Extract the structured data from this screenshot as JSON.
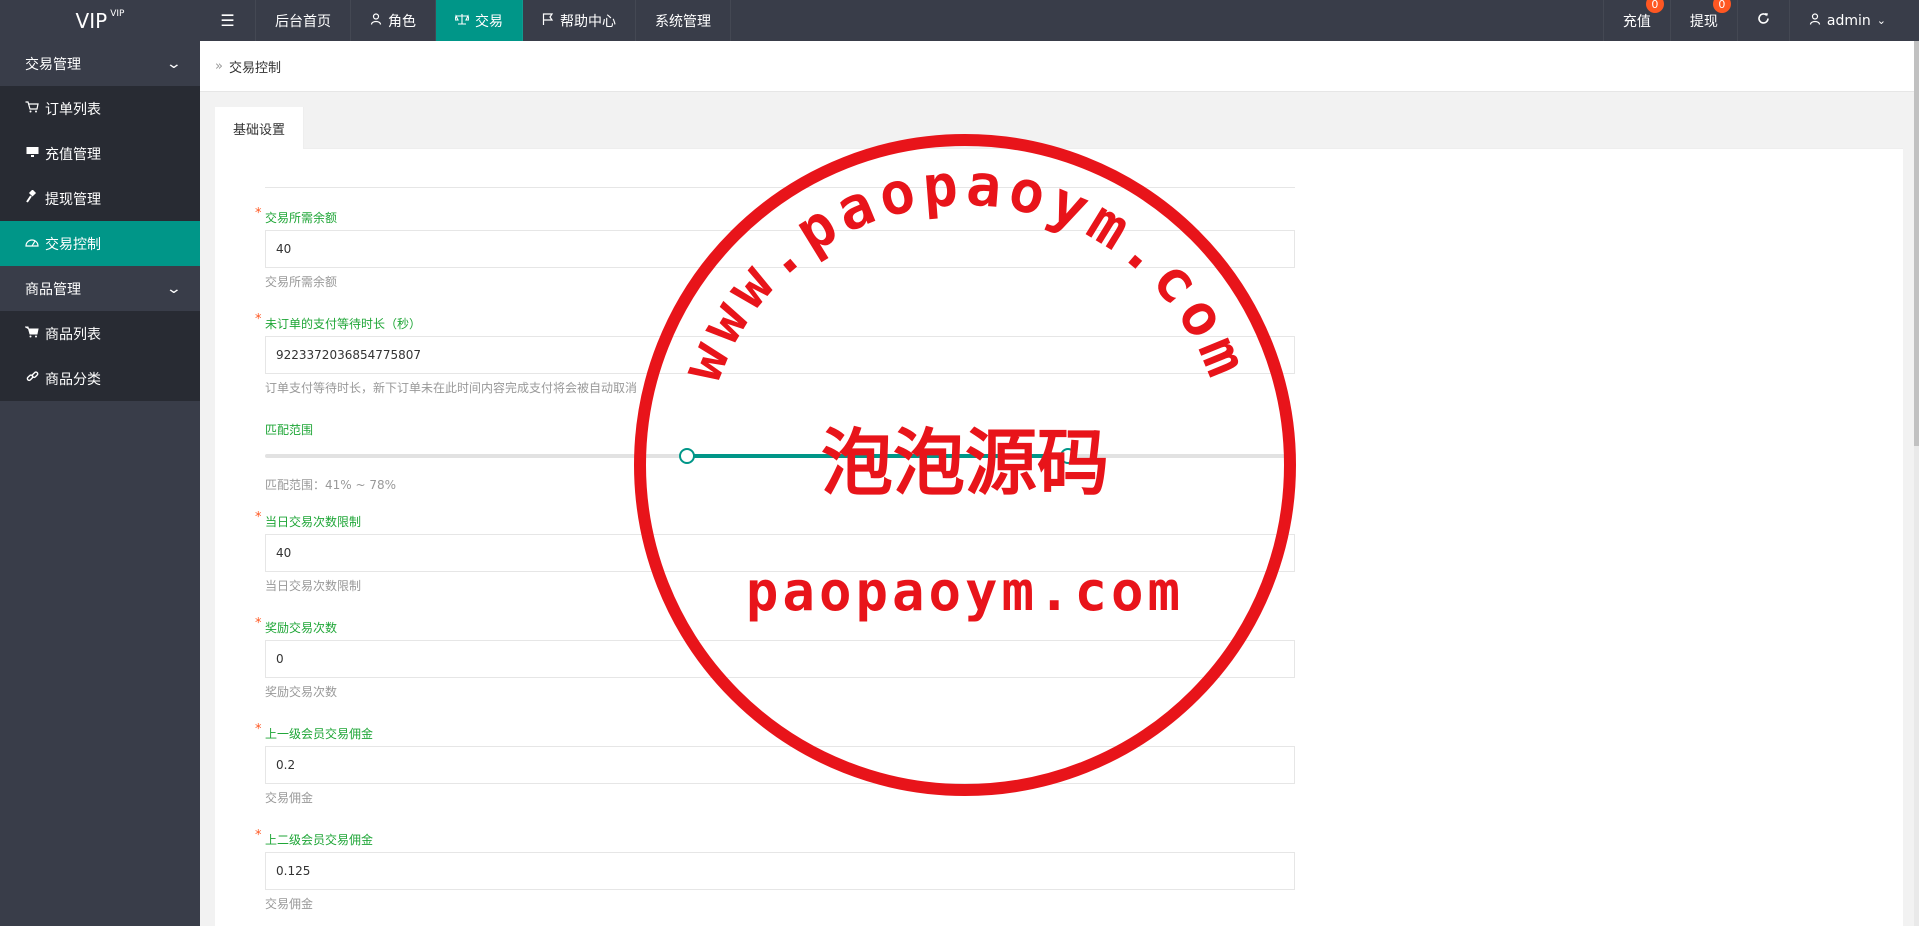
{
  "header": {
    "logo": "VIP",
    "logo_sup": "VIP",
    "menu_toggle_icon": "menu-icon",
    "nav": [
      {
        "label": "后台首页",
        "icon": ""
      },
      {
        "label": "角色",
        "icon": "user-icon"
      },
      {
        "label": "交易",
        "icon": "balance-scale-icon"
      },
      {
        "label": "帮助中心",
        "icon": "flag-icon"
      },
      {
        "label": "系统管理",
        "icon": ""
      }
    ],
    "recharge": {
      "label": "充值",
      "badge": "0"
    },
    "withdraw": {
      "label": "提现",
      "badge": "0"
    },
    "refresh_icon": "refresh-icon",
    "user": {
      "label": "admin",
      "icon": "user-icon"
    }
  },
  "sidebar": {
    "group1": "交易管理",
    "items1": [
      {
        "label": "订单列表",
        "icon": "cart-icon"
      },
      {
        "label": "充值管理",
        "icon": "monitor-icon"
      },
      {
        "label": "提现管理",
        "icon": "gavel-icon"
      },
      {
        "label": "交易控制",
        "icon": "dashboard-icon"
      }
    ],
    "group2": "商品管理",
    "items2": [
      {
        "label": "商品列表",
        "icon": "cart-icon"
      },
      {
        "label": "商品分类",
        "icon": "link-icon"
      }
    ]
  },
  "breadcrumb": {
    "sep": "»",
    "current": "交易控制"
  },
  "tabs": [
    "基础设置"
  ],
  "form": {
    "balance": {
      "label": "交易所需余额",
      "value": "40",
      "help": "交易所需余额"
    },
    "wait": {
      "label": "未订单的支付等待时长（秒）",
      "value": "9223372036854775807",
      "help": "订单支付等待时长，新下订单未在此时间内容完成支付将会被自动取消"
    },
    "range": {
      "label": "匹配范围",
      "min": 41,
      "max": 78,
      "help": "匹配范围：41% ~ 78%"
    },
    "daily": {
      "label": "当日交易次数限制",
      "value": "40",
      "help": "当日交易次数限制"
    },
    "reward": {
      "label": "奖励交易次数",
      "value": "0",
      "help": "奖励交易次数"
    },
    "commission1": {
      "label": "上一级会员交易佣金",
      "value": "0.2",
      "help": "交易佣金"
    },
    "commission2": {
      "label": "上二级会员交易佣金",
      "value": "0.125",
      "help": "交易佣金"
    }
  },
  "watermark": {
    "arc_text": "www.paopaoym.com",
    "center_text": "泡泡源码",
    "bottom_text": "paopaoym.com",
    "color": "#e8141a"
  },
  "colors": {
    "accent": "#009688",
    "header": "#393d49",
    "label": "#1fa637",
    "required": "#ff5722"
  }
}
